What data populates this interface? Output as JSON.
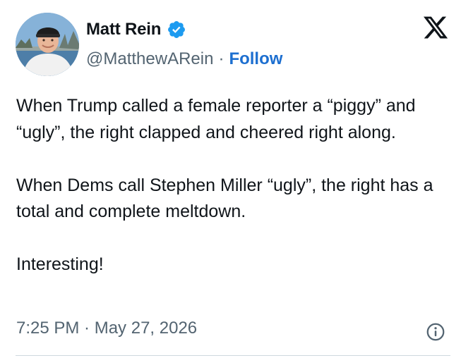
{
  "tweet": {
    "author": {
      "display_name": "Matt Rein",
      "handle": "@MatthewARein",
      "verified": true,
      "verified_color": "#1d9bf0"
    },
    "separator": "·",
    "follow_label": "Follow",
    "text_paragraphs": [
      "When Trump called a female reporter a “piggy” and “ugly”, the right clapped and cheered right along.",
      "When Dems call Stephen Miller “ugly”, the right has a total and complete meltdown.",
      "Interesting!"
    ],
    "timestamp": "7:25 PM · May 27, 2026"
  },
  "icons": {
    "platform_logo": "x-logo-icon",
    "verified": "verified-badge-icon",
    "info": "info-icon"
  },
  "colors": {
    "text_primary": "#0f1419",
    "text_secondary": "#536471",
    "link": "#1d6fd0",
    "divider": "#cfd9de"
  }
}
